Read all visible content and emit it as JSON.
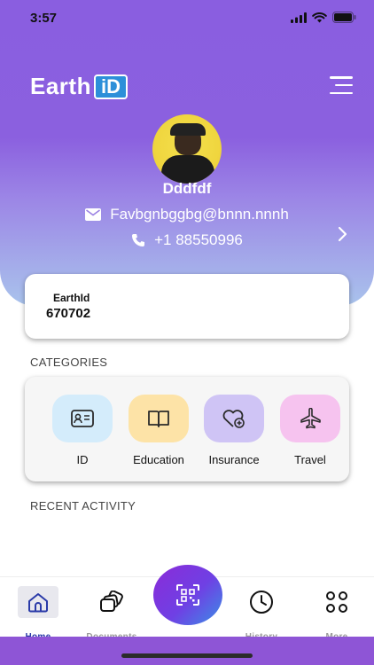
{
  "status_bar": {
    "time": "3:57"
  },
  "brand": {
    "word": "Earth",
    "badge": "iD"
  },
  "profile": {
    "name": "Dddfdf",
    "email": "Favbgnbggbg@bnnn.nnnh",
    "phone": "+1 88550996"
  },
  "earth_id": {
    "label": "EarthId",
    "value": "670702"
  },
  "categories": {
    "title": "CATEGORIES",
    "items": [
      {
        "label": "ID",
        "icon": "id-card-icon",
        "color": "#d4ecfb"
      },
      {
        "label": "Education",
        "icon": "book-icon",
        "color": "#fde3a7"
      },
      {
        "label": "Insurance",
        "icon": "heart-plus-icon",
        "color": "#cfc4f5"
      },
      {
        "label": "Travel",
        "icon": "plane-icon",
        "color": "#f6c3ef"
      }
    ]
  },
  "recent": {
    "title": "RECENT ACTIVITY"
  },
  "tabbar": {
    "items": [
      {
        "label": "Home",
        "icon": "home-icon",
        "active": true
      },
      {
        "label": "Documents",
        "icon": "documents-icon"
      },
      {
        "label": "History",
        "icon": "clock-icon"
      },
      {
        "label": "More",
        "icon": "grid-icon"
      }
    ],
    "scan_icon": "qr-scan-icon"
  },
  "colors": {
    "hero_top": "#8a5ee0",
    "hero_bottom": "#a9c3ec",
    "active_tab": "#2a3aa8",
    "bottom_strip": "#8e55d6"
  }
}
